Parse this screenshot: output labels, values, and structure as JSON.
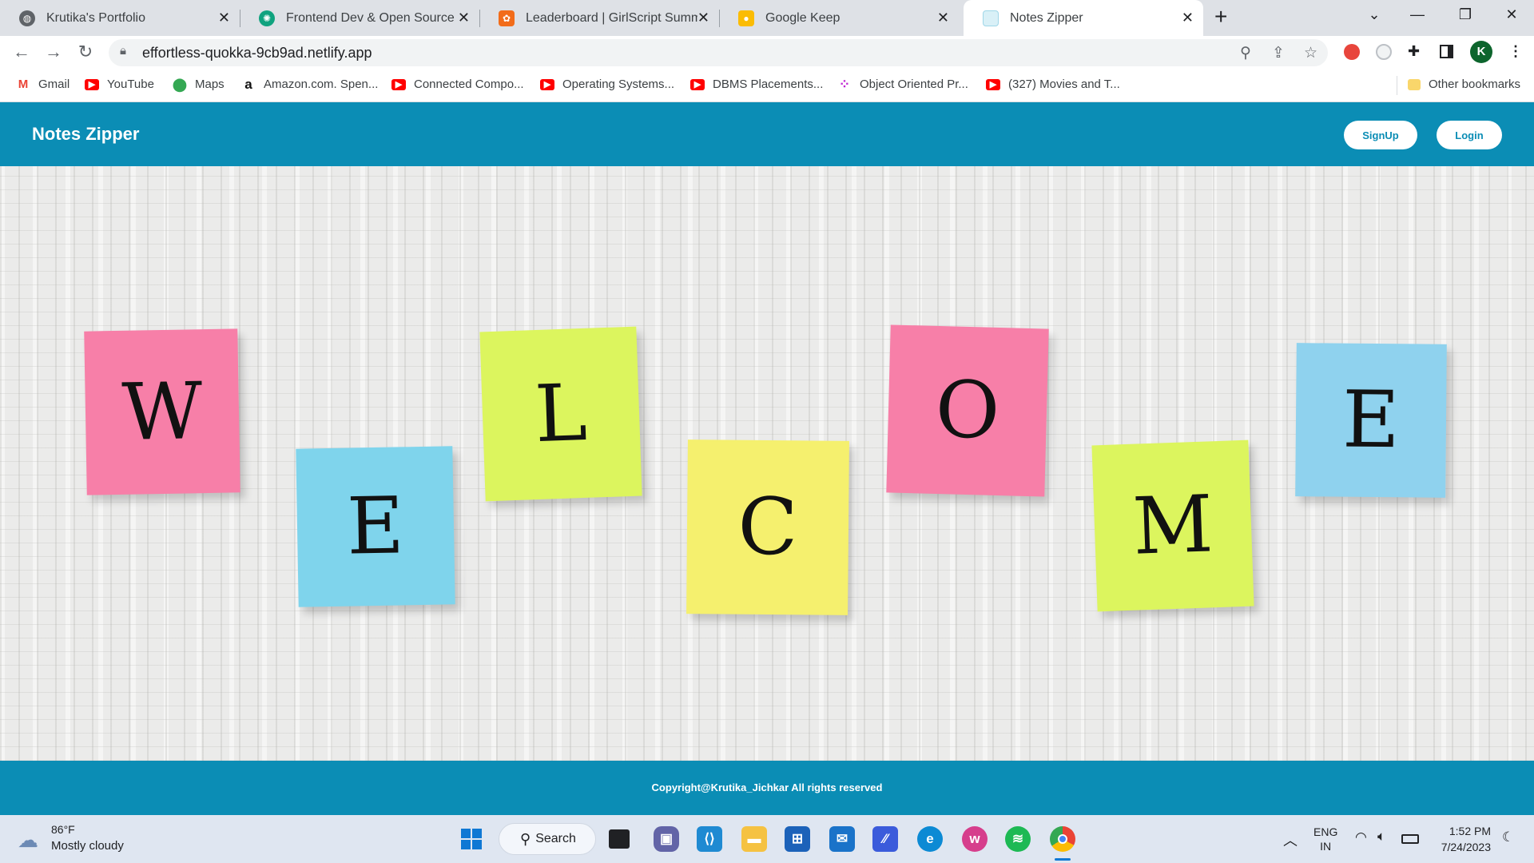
{
  "browser": {
    "tabs": [
      {
        "title": "Krutika's Portfolio",
        "icon": "globe-icon",
        "color": "#5f6368",
        "close": "✕"
      },
      {
        "title": "Frontend Dev & Open Source",
        "icon": "openai-icon",
        "color": "#10a37f",
        "close": "✕"
      },
      {
        "title": "Leaderboard | GirlScript Summer",
        "icon": "girlscript-icon",
        "color": "#f26c1a",
        "close": "✕"
      },
      {
        "title": "Google Keep",
        "icon": "keep-icon",
        "color": "#fbbc04",
        "close": "✕"
      },
      {
        "title": "Notes Zipper",
        "icon": "page-icon",
        "color": "#9fd6e8",
        "close": "✕",
        "active": true
      }
    ],
    "new_tab": "+",
    "url": "effortless-quokka-9cb9ad.netlify.app",
    "profile_initial": "K",
    "bookmarks": [
      {
        "label": "Gmail",
        "icon": "gmail-icon",
        "color": "#ea4335",
        "glyph": "M"
      },
      {
        "label": "YouTube",
        "icon": "youtube-icon",
        "color": "#ff0000",
        "glyph": "▶"
      },
      {
        "label": "Maps",
        "icon": "maps-icon",
        "color": "#34a853",
        "glyph": "⬤"
      },
      {
        "label": "Amazon.com. Spen...",
        "icon": "amazon-icon",
        "color": "#ffffff",
        "glyph": "a"
      },
      {
        "label": "Connected Compo...",
        "icon": "youtube-icon",
        "color": "#ff0000",
        "glyph": "▶"
      },
      {
        "label": "Operating Systems...",
        "icon": "youtube-icon",
        "color": "#ff0000",
        "glyph": "▶"
      },
      {
        "label": "DBMS Placements...",
        "icon": "youtube-icon",
        "color": "#ff0000",
        "glyph": "▶"
      },
      {
        "label": "Object Oriented Pr...",
        "icon": "dots-icon",
        "color": "#c026d3",
        "glyph": "⁘"
      },
      {
        "label": "(327) Movies and T...",
        "icon": "youtube-icon",
        "color": "#ff0000",
        "glyph": "▶"
      }
    ],
    "other_bookmarks": "Other bookmarks"
  },
  "app": {
    "brand": "Notes Zipper",
    "signup_label": "SignUp",
    "login_label": "Login",
    "accent": "#0b8db5",
    "hero_letters": [
      {
        "letter": "W",
        "color": "#f77fa8"
      },
      {
        "letter": "E",
        "color": "#7fd4ec"
      },
      {
        "letter": "L",
        "color": "#dcf55e"
      },
      {
        "letter": "C",
        "color": "#f5f06e"
      },
      {
        "letter": "O",
        "color": "#f77fa8"
      },
      {
        "letter": "M",
        "color": "#dcf55e"
      },
      {
        "letter": "E",
        "color": "#8fd2ee"
      }
    ],
    "footer_text": "Copyright@Krutika_Jichkar All rights reserved"
  },
  "taskbar": {
    "weather_temp": "86°F",
    "weather_desc": "Mostly cloudy",
    "search_label": "Search",
    "lang_line1": "ENG",
    "lang_line2": "IN",
    "time": "1:52 PM",
    "date": "7/24/2023"
  }
}
